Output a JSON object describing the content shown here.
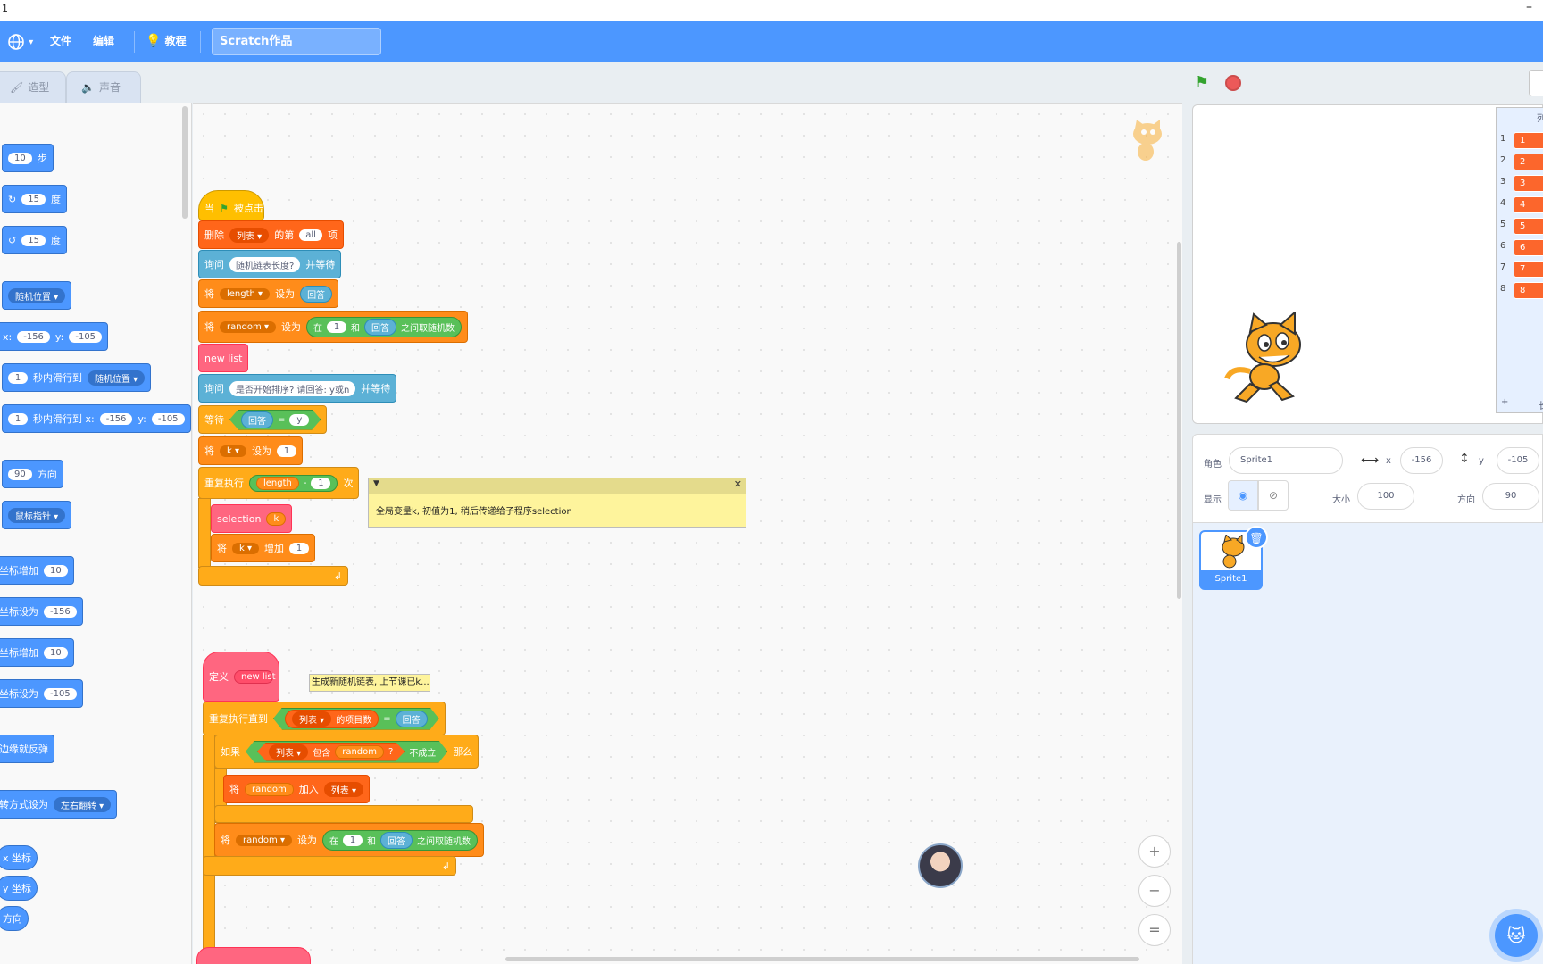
{
  "window": {
    "title": "1",
    "minimize_glyph": "–"
  },
  "menubar": {
    "language_icon": "globe-icon",
    "file": "文件",
    "edit": "编辑",
    "tutorials": "教程",
    "project_title": "Scratch作品"
  },
  "editor_tabs": {
    "costumes": "造型",
    "sounds": "声音"
  },
  "palette": {
    "move_steps": "10",
    "move_label": "步",
    "turn_right": "15",
    "turn_left": "15",
    "degrees_label": "度",
    "goto_random": "随机位置",
    "goto_x": "-156",
    "goto_y": "-105",
    "x_label": "x:",
    "y_label": "y:",
    "glide_secs": "1",
    "glide_to_label": "秒内滑行到",
    "glide_target": "随机位置",
    "glide2_secs": "1",
    "glide_xy_label": "秒内滑行到 x:",
    "glide2_x": "-156",
    "glide2_y": "-105",
    "direction_value": "90",
    "direction_label": "方向",
    "point_towards": "鼠标指针",
    "change_x_label": "坐标增加",
    "change_x_value": "10",
    "set_x_label": "坐标设为",
    "set_x_value": "-156",
    "change_y_label": "坐标增加",
    "change_y_value": "10",
    "set_y_label": "坐标设为",
    "set_y_value": "-105",
    "bounce_label": "边缘就反弹",
    "rotation_label": "转方式设为",
    "rotation_value": "左右翻转",
    "x_position": "x 坐标",
    "y_position": "y 坐标",
    "direction_reporter": "方向"
  },
  "script1": {
    "hat_when": "当",
    "hat_clicked": "被点击",
    "delete_label": "删除",
    "delete_list": "列表",
    "delete_of": "的第",
    "delete_all": "all",
    "delete_item": "项",
    "ask1_label": "询问",
    "ask1_question": "随机链表长度?",
    "ask1_wait": "并等待",
    "set1_label": "将",
    "set1_var": "length",
    "set1_to": "设为",
    "set1_value": "回答",
    "set2_label": "将",
    "set2_var": "random",
    "set2_to": "设为",
    "set2_in": "在",
    "set2_from": "1",
    "set2_and": "和",
    "set2_answer": "回答",
    "set2_rand": "之间取随机数",
    "newlist_call": "new list",
    "ask2_label": "询问",
    "ask2_question": "是否开始排序? 请回答: y或n",
    "ask2_wait": "并等待",
    "wait_label": "等待",
    "wait_answer": "回答",
    "wait_eq": "=",
    "wait_value": "y",
    "set3_label": "将",
    "set3_var": "k",
    "set3_to": "设为",
    "set3_value": "1",
    "repeat_label": "重复执行",
    "repeat_var": "length",
    "repeat_minus": "-",
    "repeat_value": "1",
    "repeat_times": "次",
    "selection_call": "selection",
    "selection_arg": "k",
    "change_label": "将",
    "change_var": "k",
    "change_by": "增加",
    "change_value": "1"
  },
  "comment1": "全局变量k, 初值为1, 稍后传递给子程序selection",
  "comment2": "生成新随机链表, 上节课已k...",
  "script2": {
    "define_label": "定义",
    "define_name": "new list",
    "until_label": "重复执行直到",
    "until_list": "列表",
    "until_count": "的项目数",
    "until_eq": "=",
    "until_answer": "回答",
    "if_label": "如果",
    "if_list": "列表",
    "if_contains": "包含",
    "if_item": "random",
    "if_q": "?",
    "if_not": "不成立",
    "if_then": "那么",
    "add_label": "将",
    "add_item": "random",
    "add_to": "加入",
    "add_list": "列表",
    "set_label": "将",
    "set_var": "random",
    "set_to": "设为",
    "set_in": "在",
    "set_from": "1",
    "set_and": "和",
    "set_answer": "回答",
    "set_rand": "之间取随机数"
  },
  "zoom": {
    "in": "+",
    "out": "−",
    "reset": "="
  },
  "list_monitor": {
    "header": "列",
    "items": [
      "1",
      "2",
      "3",
      "4",
      "5",
      "6",
      "7",
      "8"
    ],
    "add": "+",
    "length_label": "长"
  },
  "sprite_info": {
    "sprite_label": "角色",
    "sprite_name": "Sprite1",
    "x_label": "x",
    "x_value": "-156",
    "y_label": "y",
    "y_value": "-105",
    "show_label": "显示",
    "size_label": "大小",
    "size_value": "100",
    "direction_label": "方向",
    "direction_value": "90"
  },
  "sprite_tile": {
    "name": "Sprite1"
  }
}
